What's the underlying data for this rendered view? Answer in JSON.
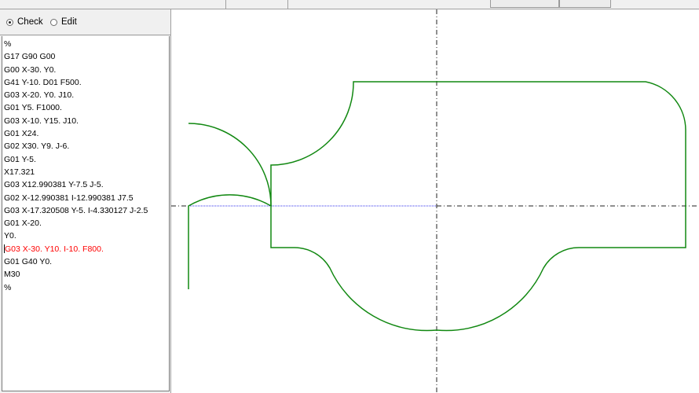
{
  "mode": {
    "options": [
      {
        "label": "Check",
        "selected": true
      },
      {
        "label": "Edit",
        "selected": false
      }
    ]
  },
  "program": {
    "lines": [
      "%",
      "G17 G90 G00",
      "G00 X-30. Y0.",
      "G41 Y-10. D01 F500.",
      "G03 X-20. Y0. J10.",
      "G01 Y5. F1000.",
      "G03 X-10. Y15. J10.",
      "G01 X24.",
      "G02 X30. Y9. J-6.",
      "G01 Y-5.",
      "X17.321",
      "G03 X12.990381 Y-7.5 J-5.",
      "G02 X-12.990381 I-12.990381 J7.5",
      "G03 X-17.320508 Y-5. I-4.330127 J-2.5",
      "G01 X-20.",
      "Y0.",
      "G03 X-30. Y10. I-10. F800.",
      "G01 G40 Y0.",
      "M30",
      "%"
    ],
    "active_line_index": 16
  },
  "colors": {
    "toolpath": "#118811",
    "rapid": "#3333ee",
    "axis": "#222222",
    "active_line": "#ff0000"
  }
}
